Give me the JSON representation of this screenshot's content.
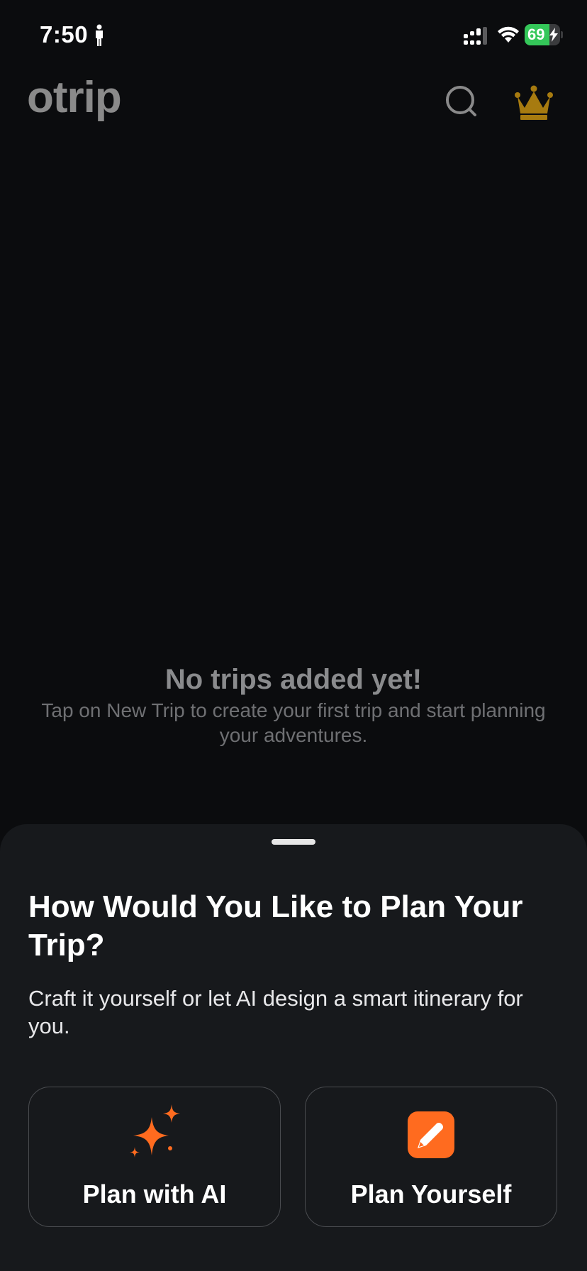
{
  "status_bar": {
    "time": "7:50",
    "battery_level": "69",
    "battery_fraction": 0.69,
    "battery_color": "#34c759"
  },
  "header": {
    "logo": "otrip",
    "search_icon": "search-icon",
    "premium_icon": "crown-icon",
    "premium_color": "#a77b10"
  },
  "empty_state": {
    "title": "No trips added yet!",
    "subtitle": "Tap on New Trip to create your first trip and start planning your adventures."
  },
  "sheet": {
    "title": "How Would You Like to Plan Your Trip?",
    "subtitle": "Craft it yourself or let AI design a smart itinerary for you.",
    "options": [
      {
        "label": "Plan with AI",
        "icon": "sparkles-icon"
      },
      {
        "label": "Plan Yourself",
        "icon": "edit-icon"
      }
    ],
    "accent_color": "#ff6b1f"
  }
}
